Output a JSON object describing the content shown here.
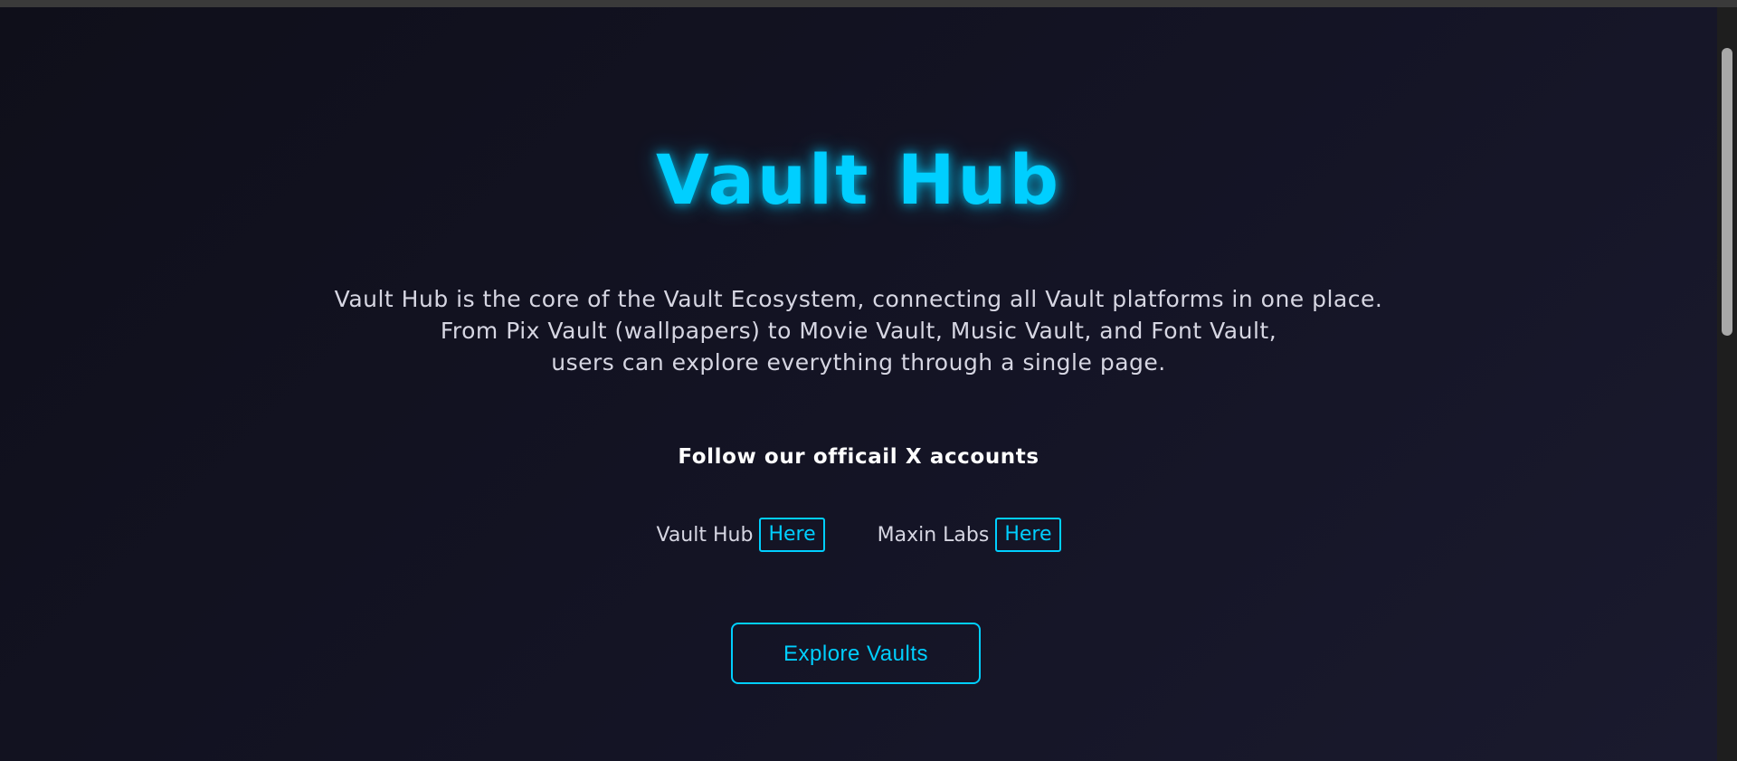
{
  "hero": {
    "title": "Vault Hub",
    "description_lines": [
      "Vault Hub is the core of the Vault Ecosystem, connecting all Vault platforms in one place.",
      "From Pix Vault (wallpapers) to Movie Vault, Music Vault, and Font Vault,",
      "users can explore everything through a single page."
    ]
  },
  "social": {
    "heading": "Follow our officail X accounts",
    "accounts": [
      {
        "name": "Vault Hub",
        "link_label": "Here"
      },
      {
        "name": "Maxin Labs",
        "link_label": "Here"
      }
    ]
  },
  "cta": {
    "label": "Explore Vaults"
  },
  "colors": {
    "accent": "#00cfff",
    "background": "#141425",
    "text": "#d6d6e2"
  }
}
